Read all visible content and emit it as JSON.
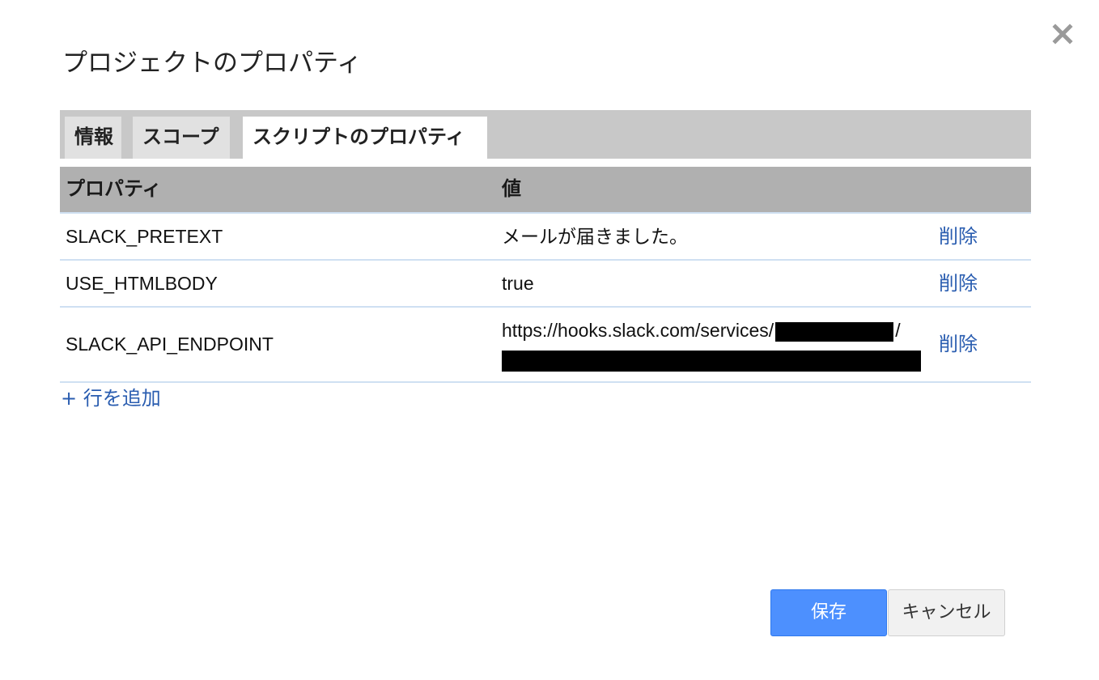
{
  "dialog": {
    "title": "プロジェクトのプロパティ",
    "close_icon": "close-icon"
  },
  "tabs": [
    {
      "label": "情報",
      "active": false
    },
    {
      "label": "スコープ",
      "active": false
    },
    {
      "label": "スクリプトのプロパティ",
      "active": true
    }
  ],
  "table": {
    "headers": {
      "property": "プロパティ",
      "value": "値"
    },
    "rows": [
      {
        "key": "SLACK_PRETEXT",
        "value": "メールが届きました。",
        "delete_label": "削除"
      },
      {
        "key": "USE_HTMLBODY",
        "value": "true",
        "delete_label": "削除"
      },
      {
        "key": "SLACK_API_ENDPOINT",
        "value_prefix": "https://hooks.slack.com/services/",
        "value_suffix": "/",
        "redacted": true,
        "delete_label": "削除"
      }
    ]
  },
  "add_row_label": "+ 行を追加",
  "buttons": {
    "save": "保存",
    "cancel": "キャンセル"
  },
  "colors": {
    "accent": "#4d90fe",
    "link": "#2a5db0",
    "tabbar": "#c8c8c8",
    "header": "#b0b0b0"
  }
}
